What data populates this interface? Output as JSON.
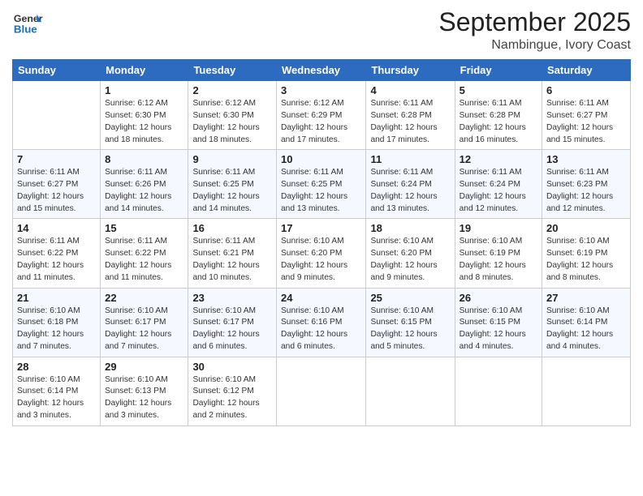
{
  "header": {
    "logo_general": "General",
    "logo_blue": "Blue",
    "month_title": "September 2025",
    "subtitle": "Nambingue, Ivory Coast"
  },
  "days_of_week": [
    "Sunday",
    "Monday",
    "Tuesday",
    "Wednesday",
    "Thursday",
    "Friday",
    "Saturday"
  ],
  "weeks": [
    [
      {
        "day": "",
        "info": ""
      },
      {
        "day": "1",
        "info": "Sunrise: 6:12 AM\nSunset: 6:30 PM\nDaylight: 12 hours\nand 18 minutes."
      },
      {
        "day": "2",
        "info": "Sunrise: 6:12 AM\nSunset: 6:30 PM\nDaylight: 12 hours\nand 18 minutes."
      },
      {
        "day": "3",
        "info": "Sunrise: 6:12 AM\nSunset: 6:29 PM\nDaylight: 12 hours\nand 17 minutes."
      },
      {
        "day": "4",
        "info": "Sunrise: 6:11 AM\nSunset: 6:28 PM\nDaylight: 12 hours\nand 17 minutes."
      },
      {
        "day": "5",
        "info": "Sunrise: 6:11 AM\nSunset: 6:28 PM\nDaylight: 12 hours\nand 16 minutes."
      },
      {
        "day": "6",
        "info": "Sunrise: 6:11 AM\nSunset: 6:27 PM\nDaylight: 12 hours\nand 15 minutes."
      }
    ],
    [
      {
        "day": "7",
        "info": "Sunrise: 6:11 AM\nSunset: 6:27 PM\nDaylight: 12 hours\nand 15 minutes."
      },
      {
        "day": "8",
        "info": "Sunrise: 6:11 AM\nSunset: 6:26 PM\nDaylight: 12 hours\nand 14 minutes."
      },
      {
        "day": "9",
        "info": "Sunrise: 6:11 AM\nSunset: 6:25 PM\nDaylight: 12 hours\nand 14 minutes."
      },
      {
        "day": "10",
        "info": "Sunrise: 6:11 AM\nSunset: 6:25 PM\nDaylight: 12 hours\nand 13 minutes."
      },
      {
        "day": "11",
        "info": "Sunrise: 6:11 AM\nSunset: 6:24 PM\nDaylight: 12 hours\nand 13 minutes."
      },
      {
        "day": "12",
        "info": "Sunrise: 6:11 AM\nSunset: 6:24 PM\nDaylight: 12 hours\nand 12 minutes."
      },
      {
        "day": "13",
        "info": "Sunrise: 6:11 AM\nSunset: 6:23 PM\nDaylight: 12 hours\nand 12 minutes."
      }
    ],
    [
      {
        "day": "14",
        "info": "Sunrise: 6:11 AM\nSunset: 6:22 PM\nDaylight: 12 hours\nand 11 minutes."
      },
      {
        "day": "15",
        "info": "Sunrise: 6:11 AM\nSunset: 6:22 PM\nDaylight: 12 hours\nand 11 minutes."
      },
      {
        "day": "16",
        "info": "Sunrise: 6:11 AM\nSunset: 6:21 PM\nDaylight: 12 hours\nand 10 minutes."
      },
      {
        "day": "17",
        "info": "Sunrise: 6:10 AM\nSunset: 6:20 PM\nDaylight: 12 hours\nand 9 minutes."
      },
      {
        "day": "18",
        "info": "Sunrise: 6:10 AM\nSunset: 6:20 PM\nDaylight: 12 hours\nand 9 minutes."
      },
      {
        "day": "19",
        "info": "Sunrise: 6:10 AM\nSunset: 6:19 PM\nDaylight: 12 hours\nand 8 minutes."
      },
      {
        "day": "20",
        "info": "Sunrise: 6:10 AM\nSunset: 6:19 PM\nDaylight: 12 hours\nand 8 minutes."
      }
    ],
    [
      {
        "day": "21",
        "info": "Sunrise: 6:10 AM\nSunset: 6:18 PM\nDaylight: 12 hours\nand 7 minutes."
      },
      {
        "day": "22",
        "info": "Sunrise: 6:10 AM\nSunset: 6:17 PM\nDaylight: 12 hours\nand 7 minutes."
      },
      {
        "day": "23",
        "info": "Sunrise: 6:10 AM\nSunset: 6:17 PM\nDaylight: 12 hours\nand 6 minutes."
      },
      {
        "day": "24",
        "info": "Sunrise: 6:10 AM\nSunset: 6:16 PM\nDaylight: 12 hours\nand 6 minutes."
      },
      {
        "day": "25",
        "info": "Sunrise: 6:10 AM\nSunset: 6:15 PM\nDaylight: 12 hours\nand 5 minutes."
      },
      {
        "day": "26",
        "info": "Sunrise: 6:10 AM\nSunset: 6:15 PM\nDaylight: 12 hours\nand 4 minutes."
      },
      {
        "day": "27",
        "info": "Sunrise: 6:10 AM\nSunset: 6:14 PM\nDaylight: 12 hours\nand 4 minutes."
      }
    ],
    [
      {
        "day": "28",
        "info": "Sunrise: 6:10 AM\nSunset: 6:14 PM\nDaylight: 12 hours\nand 3 minutes."
      },
      {
        "day": "29",
        "info": "Sunrise: 6:10 AM\nSunset: 6:13 PM\nDaylight: 12 hours\nand 3 minutes."
      },
      {
        "day": "30",
        "info": "Sunrise: 6:10 AM\nSunset: 6:12 PM\nDaylight: 12 hours\nand 2 minutes."
      },
      {
        "day": "",
        "info": ""
      },
      {
        "day": "",
        "info": ""
      },
      {
        "day": "",
        "info": ""
      },
      {
        "day": "",
        "info": ""
      }
    ]
  ]
}
